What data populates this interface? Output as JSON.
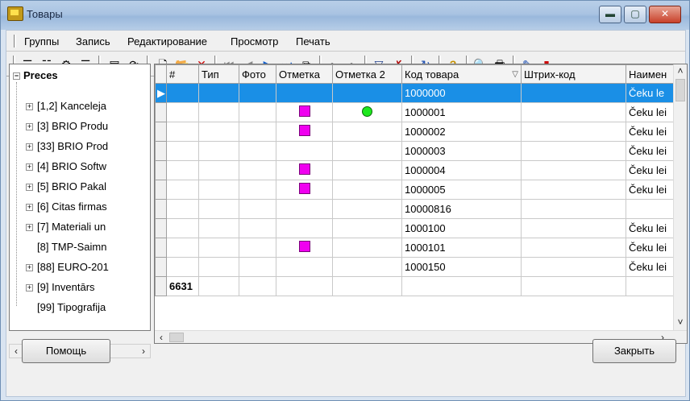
{
  "window": {
    "title": "Товары"
  },
  "menu": [
    "Группы",
    "Запись",
    "Редактирование",
    "Просмотр",
    "Печать"
  ],
  "tree": {
    "root": "Preces",
    "items": [
      "[1,2] Kanceleja",
      "[3] BRIO Produ",
      "[33] BRIO Prod",
      "[4] BRIO Softw",
      "[5] BRIO Pakal",
      "[6] Citas firmas",
      "[7] Materiali un",
      "[8] TMP-Saimn",
      "[88] EURO-201",
      "[9] Inventārs",
      "[99] Tipografija"
    ]
  },
  "grid": {
    "columns": [
      "#",
      "Тип",
      "Фото",
      "Отметка",
      "Отметка 2",
      "Код товара",
      "Штрих-код",
      "Наимен"
    ],
    "rows": [
      {
        "code": "1000000",
        "name": "Čeku le",
        "mark": "",
        "mark2": ""
      },
      {
        "code": "1000001",
        "name": "Čeku lei",
        "mark": "magenta-square",
        "mark2": "green-circle"
      },
      {
        "code": "1000002",
        "name": "Čeku lei",
        "mark": "magenta-square",
        "mark2": ""
      },
      {
        "code": "1000003",
        "name": "Čeku lei",
        "mark": "",
        "mark2": ""
      },
      {
        "code": "1000004",
        "name": "Čeku lei",
        "mark": "magenta-square",
        "mark2": ""
      },
      {
        "code": "1000005",
        "name": "Čeku lei",
        "mark": "magenta-square",
        "mark2": ""
      },
      {
        "code": "10000816",
        "name": "",
        "mark": "",
        "mark2": ""
      },
      {
        "code": "1000100",
        "name": "Čeku lei",
        "mark": "",
        "mark2": ""
      },
      {
        "code": "1000101",
        "name": "Čeku lei",
        "mark": "magenta-square",
        "mark2": ""
      },
      {
        "code": "1000150",
        "name": "Čeku lei",
        "mark": "",
        "mark2": ""
      }
    ],
    "total_count": "6631",
    "selected_row": 0
  },
  "buttons": {
    "help": "Помощь",
    "close": "Закрыть"
  },
  "colors": {
    "selection": "#1a8fe6",
    "mark_square": "#f000f0",
    "mark_circle": "#1ee81e"
  }
}
